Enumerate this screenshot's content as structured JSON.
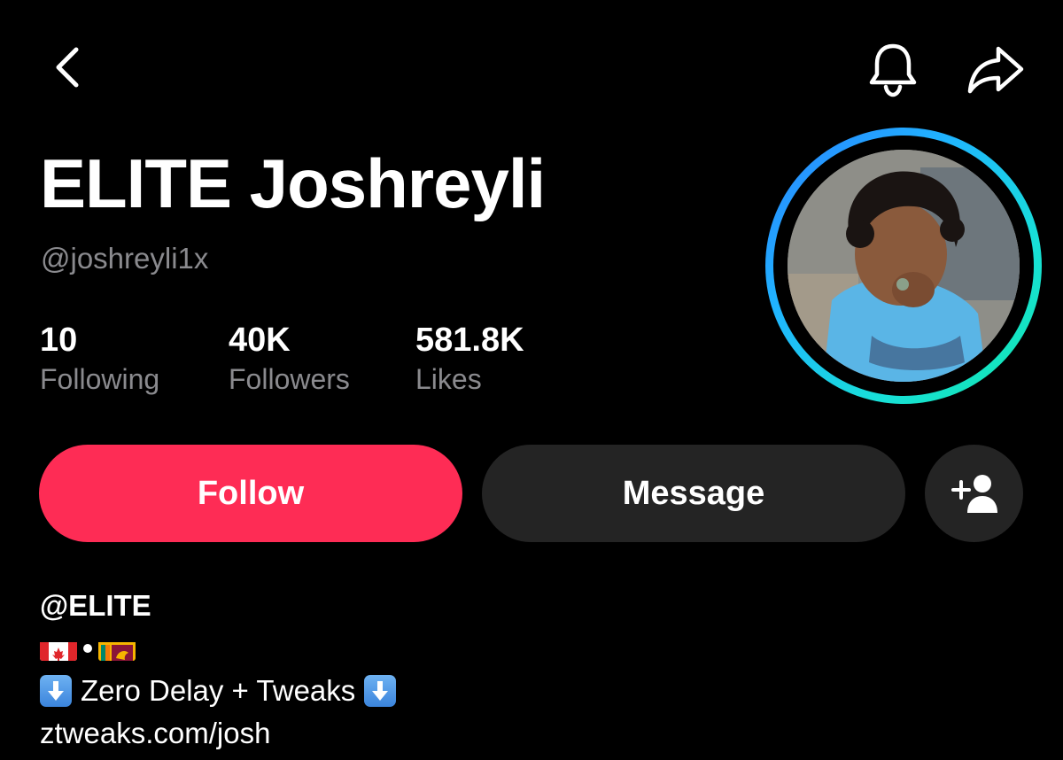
{
  "profile": {
    "display_name": "ELITE Joshreyli",
    "username": "@joshreyli1x"
  },
  "stats": {
    "following": {
      "value": "10",
      "label": "Following"
    },
    "followers": {
      "value": "40K",
      "label": "Followers"
    },
    "likes": {
      "value": "581.8K",
      "label": "Likes"
    }
  },
  "actions": {
    "follow_label": "Follow",
    "message_label": "Message"
  },
  "icons": {
    "back": "chevron-left-icon",
    "bell": "bell-icon",
    "share": "share-arrow-icon",
    "add_friend": "add-user-icon"
  },
  "bio": {
    "handle": "@ELITE",
    "flags": [
      "canada-flag",
      "sri-lanka-flag"
    ],
    "tagline": "Zero Delay + Tweaks",
    "link": "ztweaks.com/josh"
  },
  "colors": {
    "follow_button": "#fe2c55",
    "secondary_button": "#242424",
    "muted_text": "#8a8a8e",
    "ring_gradient_start": "#2a7fff",
    "ring_gradient_end": "#10e8a8"
  }
}
